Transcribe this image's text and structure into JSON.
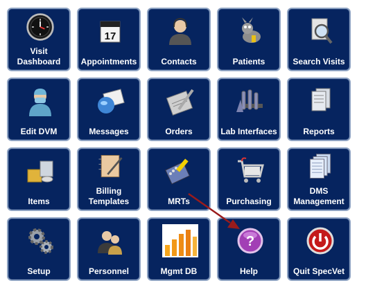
{
  "tiles": [
    {
      "id": "visit-dashboard",
      "label": "Visit\nDashboard",
      "icon": "clock-icon"
    },
    {
      "id": "appointments",
      "label": "Appointments",
      "icon": "calendar-icon",
      "calendar_day": "17"
    },
    {
      "id": "contacts",
      "label": "Contacts",
      "icon": "person-icon"
    },
    {
      "id": "patients",
      "label": "Patients",
      "icon": "animal-icon"
    },
    {
      "id": "search-visits",
      "label": "Search Visits",
      "icon": "magnifier-icon"
    },
    {
      "id": "edit-dvm",
      "label": "Edit DVM",
      "icon": "doctor-icon"
    },
    {
      "id": "messages",
      "label": "Messages",
      "icon": "mail-icon"
    },
    {
      "id": "orders",
      "label": "Orders",
      "icon": "pen-pad-icon"
    },
    {
      "id": "lab-interfaces",
      "label": "Lab Interfaces",
      "icon": "test-tubes-icon"
    },
    {
      "id": "reports",
      "label": "Reports",
      "icon": "documents-icon"
    },
    {
      "id": "items",
      "label": "Items",
      "icon": "boxes-icon"
    },
    {
      "id": "billing-templates",
      "label": "Billing\nTemplates",
      "icon": "notebook-pen-icon"
    },
    {
      "id": "mrts",
      "label": "MRTs",
      "icon": "notebook-brush-icon"
    },
    {
      "id": "purchasing",
      "label": "Purchasing",
      "icon": "cart-icon"
    },
    {
      "id": "dms-management",
      "label": "DMS\nManagement",
      "icon": "stacked-pages-icon"
    },
    {
      "id": "setup",
      "label": "Setup",
      "icon": "gears-icon"
    },
    {
      "id": "personnel",
      "label": "Personnel",
      "icon": "people-icon"
    },
    {
      "id": "mgmt-db",
      "label": "Mgmt DB",
      "icon": "bar-chart-icon"
    },
    {
      "id": "help",
      "label": "Help",
      "icon": "question-icon"
    },
    {
      "id": "quit-specvet",
      "label": "Quit SpecVet",
      "icon": "power-icon"
    }
  ],
  "colors": {
    "tile_bg": "#06245f",
    "tile_border": "#8da2c2",
    "arrow": "#9a1b1b"
  }
}
